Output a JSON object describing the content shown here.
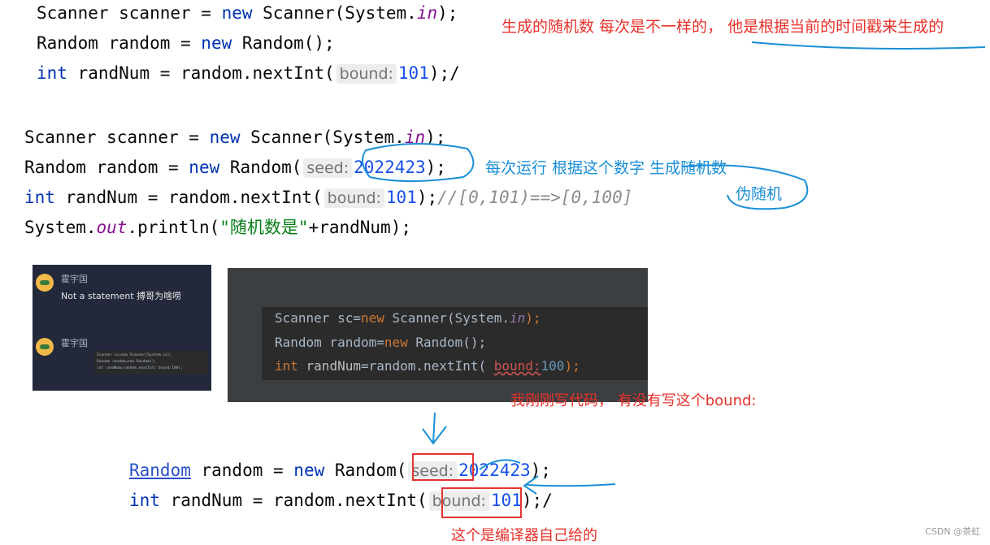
{
  "block1": {
    "line1": {
      "a": "Scanner scanner = ",
      "kw": "new",
      "b": " Scanner(System.",
      "field": "in",
      "c": ");"
    },
    "line2": {
      "a": "Random random = ",
      "kw": "new",
      "b": " Random();"
    },
    "line3": {
      "kw": "int",
      "a": " randNum = random.nextInt(",
      "hint": "bound:",
      "num": "101",
      "c": ");/"
    }
  },
  "block2": {
    "line1": {
      "a": "Scanner scanner = ",
      "kw": "new",
      "b": " Scanner(System.",
      "field": "in",
      "c": ");"
    },
    "line2": {
      "a": "Random random = ",
      "kw": "new",
      "b": " Random(",
      "hint": "seed:",
      "num": "2022423",
      "c": ");"
    },
    "line3": {
      "kw": "int",
      "a": " randNum = random.nextInt(",
      "hint": "bound:",
      "num": "101",
      "c": ");",
      "comment": "//[0,101)==>[0,100]"
    },
    "line4": {
      "a": "System.",
      "field": "out",
      "b": ".println(",
      "str": "\"随机数是\"",
      "c": "+randNum);"
    }
  },
  "chat": {
    "msg1": {
      "name": "霍宇国",
      "text": "Not a statement 搏哥为啥唠"
    },
    "msg2": {
      "name": "霍宇国"
    },
    "mini_code": {
      "l1": "Scanner sc=new Scanner(System.in);",
      "l2": "Random random=new Random();",
      "l3": "int randNum=random.nextInt( bound:100);"
    }
  },
  "dark_editor": {
    "line1": {
      "a": "Scanner sc=",
      "kw": "new",
      "b": " Scanner(System.",
      "field": "in",
      "c": ");"
    },
    "line2": {
      "a": "Random random=",
      "kw": "new",
      "b": " Random();"
    },
    "line3": {
      "kw": "int",
      "var": " randNum",
      "a": "=random.nextInt( ",
      "hint": "bound:",
      "num": "100",
      "c": ");"
    }
  },
  "block3": {
    "line1": {
      "link": "Random",
      "a": " random = ",
      "kw": "new",
      "b": " Random(",
      "hint": "seed:",
      "num": "2022423",
      "c": ");"
    },
    "line2": {
      "kw": "int",
      "a": " randNum = random.nextInt(",
      "hint": "bound:",
      "num": "101",
      "c": ");/"
    }
  },
  "notes": {
    "top": "生成的随机数   每次是不一样的， 他是根据当前的时间戳来生成的",
    "seed": "每次运行 根据这个数字 生成随机数",
    "pseudo": "伪随机",
    "bound_q": "我刚刚写代码， 有没有写这个bound:",
    "compiler": "这个是编译器自己给的"
  },
  "footer": "CSDN @茶虹",
  "colors": {
    "keyword": "#0033b3",
    "number": "#1750eb",
    "field": "#871094",
    "string": "#067d17",
    "annotation_red": "#e8312b",
    "annotation_blue": "#1a8fd6"
  }
}
